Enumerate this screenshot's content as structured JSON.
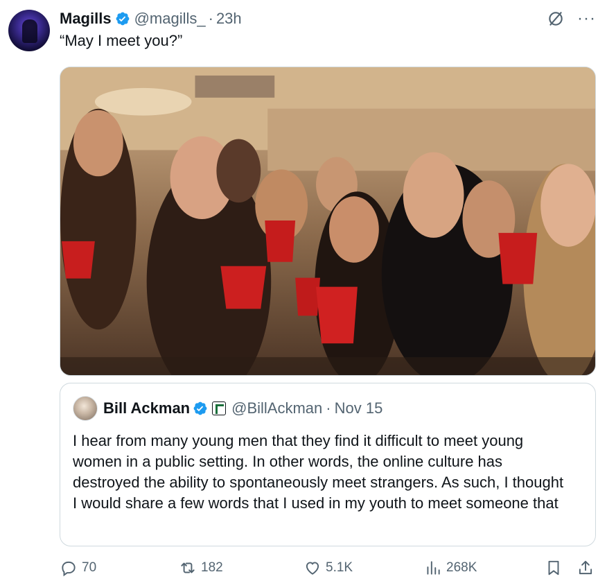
{
  "tweet": {
    "display_name": "Magills",
    "handle": "@magills_",
    "dot": "·",
    "time": "23h",
    "text": "“May I meet you?”",
    "more_label": "···"
  },
  "quote": {
    "display_name": "Bill Ackman",
    "handle": "@BillAckman",
    "dot": "·",
    "time": "Nov 15",
    "text": "I hear from many young men that they find it difficult to meet young women in a public setting. In other words, the online culture has destroyed the ability to spontaneously meet strangers. As such, I thought I would share a few words that I used in my youth to meet someone that"
  },
  "actions": {
    "replies": "70",
    "reposts": "182",
    "likes": "5.1K",
    "views": "268K"
  },
  "colors": {
    "verified": "#1d9bf0",
    "text_primary": "#0f1419",
    "text_secondary": "#536471",
    "border": "#cfd9de"
  },
  "icons": [
    "verified-badge-icon",
    "grok-icon",
    "more-icon",
    "reply-icon",
    "retweet-icon",
    "like-icon",
    "views-icon",
    "bookmark-icon",
    "share-icon",
    "affiliation-icon"
  ]
}
